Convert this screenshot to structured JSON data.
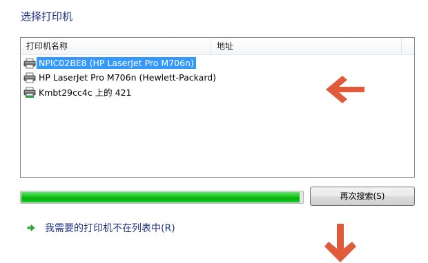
{
  "dialog": {
    "title": "选择打印机"
  },
  "printer_list": {
    "columns": [
      "打印机名称",
      "地址"
    ],
    "rows": [
      {
        "name": "NPIC02BE8 (HP LaserJet Pro M706n)",
        "address": "",
        "selected": true,
        "icon": "printer-icon"
      },
      {
        "name": "HP LaserJet Pro M706n (Hewlett-Packard)",
        "address": "",
        "selected": false,
        "icon": "printer-icon"
      },
      {
        "name": "Kmbt29cc4c 上的 421",
        "address": "",
        "selected": false,
        "icon": "network-printer-icon"
      }
    ]
  },
  "search": {
    "progress": 0.99,
    "button_label": "再次搜索(S)"
  },
  "not_listed_link": {
    "label": "我需要的打印机不在列表中(R)",
    "icon": "green-arrow-icon"
  },
  "annotations": {
    "arrow_color": "#e05a3c",
    "arrows": [
      "left-arrow-icon",
      "down-arrow-icon"
    ]
  },
  "colors": {
    "title": "#1e3287",
    "selection": "#3399ff",
    "progress": "#17c51f"
  }
}
